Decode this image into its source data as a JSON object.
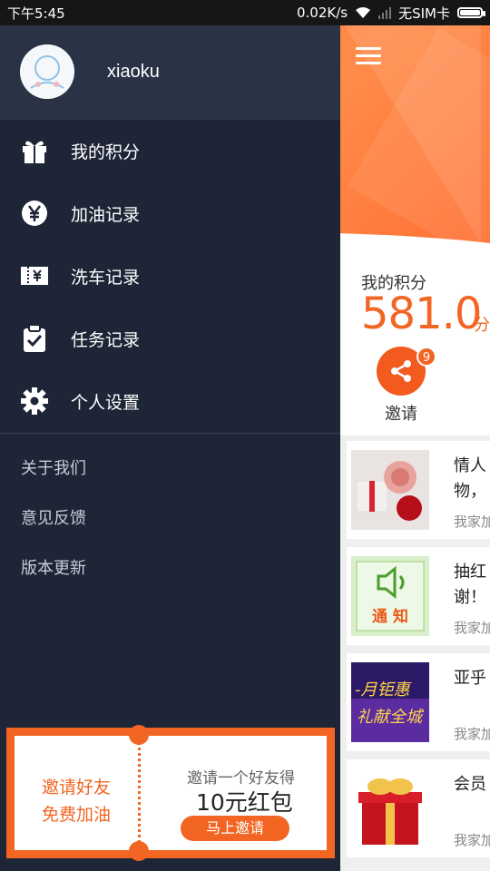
{
  "status_bar": {
    "time": "下午5:45",
    "speed": "0.02K/s",
    "sim": "无SIM卡"
  },
  "drawer": {
    "username": "xiaoku",
    "items": [
      {
        "label": "我的积分",
        "icon": "gift-icon"
      },
      {
        "label": "加油记录",
        "icon": "yuan-icon"
      },
      {
        "label": "洗车记录",
        "icon": "ticket-icon"
      },
      {
        "label": "任务记录",
        "icon": "clipboard-check-icon"
      },
      {
        "label": "个人设置",
        "icon": "gear-icon"
      }
    ],
    "links": [
      "关于我们",
      "意见反馈",
      "版本更新"
    ],
    "banner": {
      "left_line1": "邀请好友",
      "left_line2": "免费加油",
      "right_line1": "邀请一个好友得",
      "right_line2": "10元红包",
      "button": "马上邀请"
    }
  },
  "main": {
    "points_title": "我的积分",
    "points_value": "581.0",
    "points_unit": "分",
    "invite_label": "邀请",
    "invite_badge": "9",
    "feed": [
      {
        "title": "情人节\n物，",
        "source": "我家加"
      },
      {
        "title": "抽红包\n谢！",
        "source": "我家加",
        "thumb_text": "通 知"
      },
      {
        "title": "亚乎",
        "source": "我家加",
        "thumb_text": "月钜惠 礼献全城"
      },
      {
        "title": "会员",
        "source": "我家加"
      }
    ]
  },
  "colors": {
    "accent": "#f26522",
    "drawer_bg": "#1e2537",
    "drawer_header": "#2a3246"
  }
}
